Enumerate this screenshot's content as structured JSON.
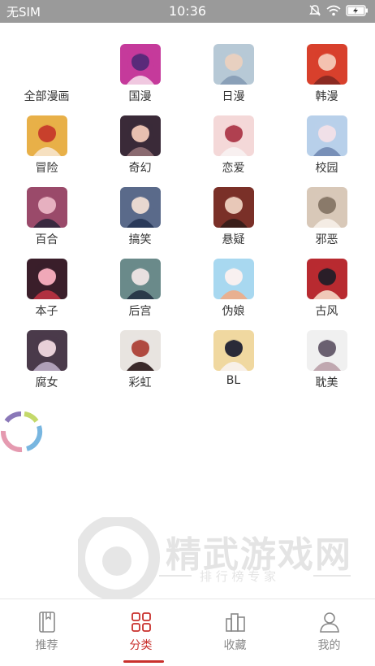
{
  "status_bar": {
    "carrier": "无SIM",
    "time": "10:36",
    "icons": [
      "mute-icon",
      "wifi-icon",
      "battery-charging-icon"
    ]
  },
  "categories": [
    {
      "label": "全部漫画",
      "has_thumb": false
    },
    {
      "label": "国漫"
    },
    {
      "label": "日漫"
    },
    {
      "label": "韩漫"
    },
    {
      "label": "冒险"
    },
    {
      "label": "奇幻"
    },
    {
      "label": "恋爱"
    },
    {
      "label": "校园"
    },
    {
      "label": "百合"
    },
    {
      "label": "搞笑"
    },
    {
      "label": "悬疑"
    },
    {
      "label": "邪恶"
    },
    {
      "label": "本子"
    },
    {
      "label": "后宫"
    },
    {
      "label": "伪娘"
    },
    {
      "label": "古风"
    },
    {
      "label": "腐女"
    },
    {
      "label": "彩虹"
    },
    {
      "label": "BL"
    },
    {
      "label": "耽美"
    }
  ],
  "watermark": {
    "title": "精武游戏网",
    "subtitle": "排 行 榜 专 家"
  },
  "bottom_nav": [
    {
      "label": "推荐",
      "icon": "book-icon",
      "active": false
    },
    {
      "label": "分类",
      "icon": "grid-icon",
      "active": true
    },
    {
      "label": "收藏",
      "icon": "bookshelf-icon",
      "active": false
    },
    {
      "label": "我的",
      "icon": "user-icon",
      "active": false
    }
  ],
  "colors": {
    "accent": "#c9302c",
    "inactive": "#888888",
    "status_bar": "#9a9a9a"
  }
}
